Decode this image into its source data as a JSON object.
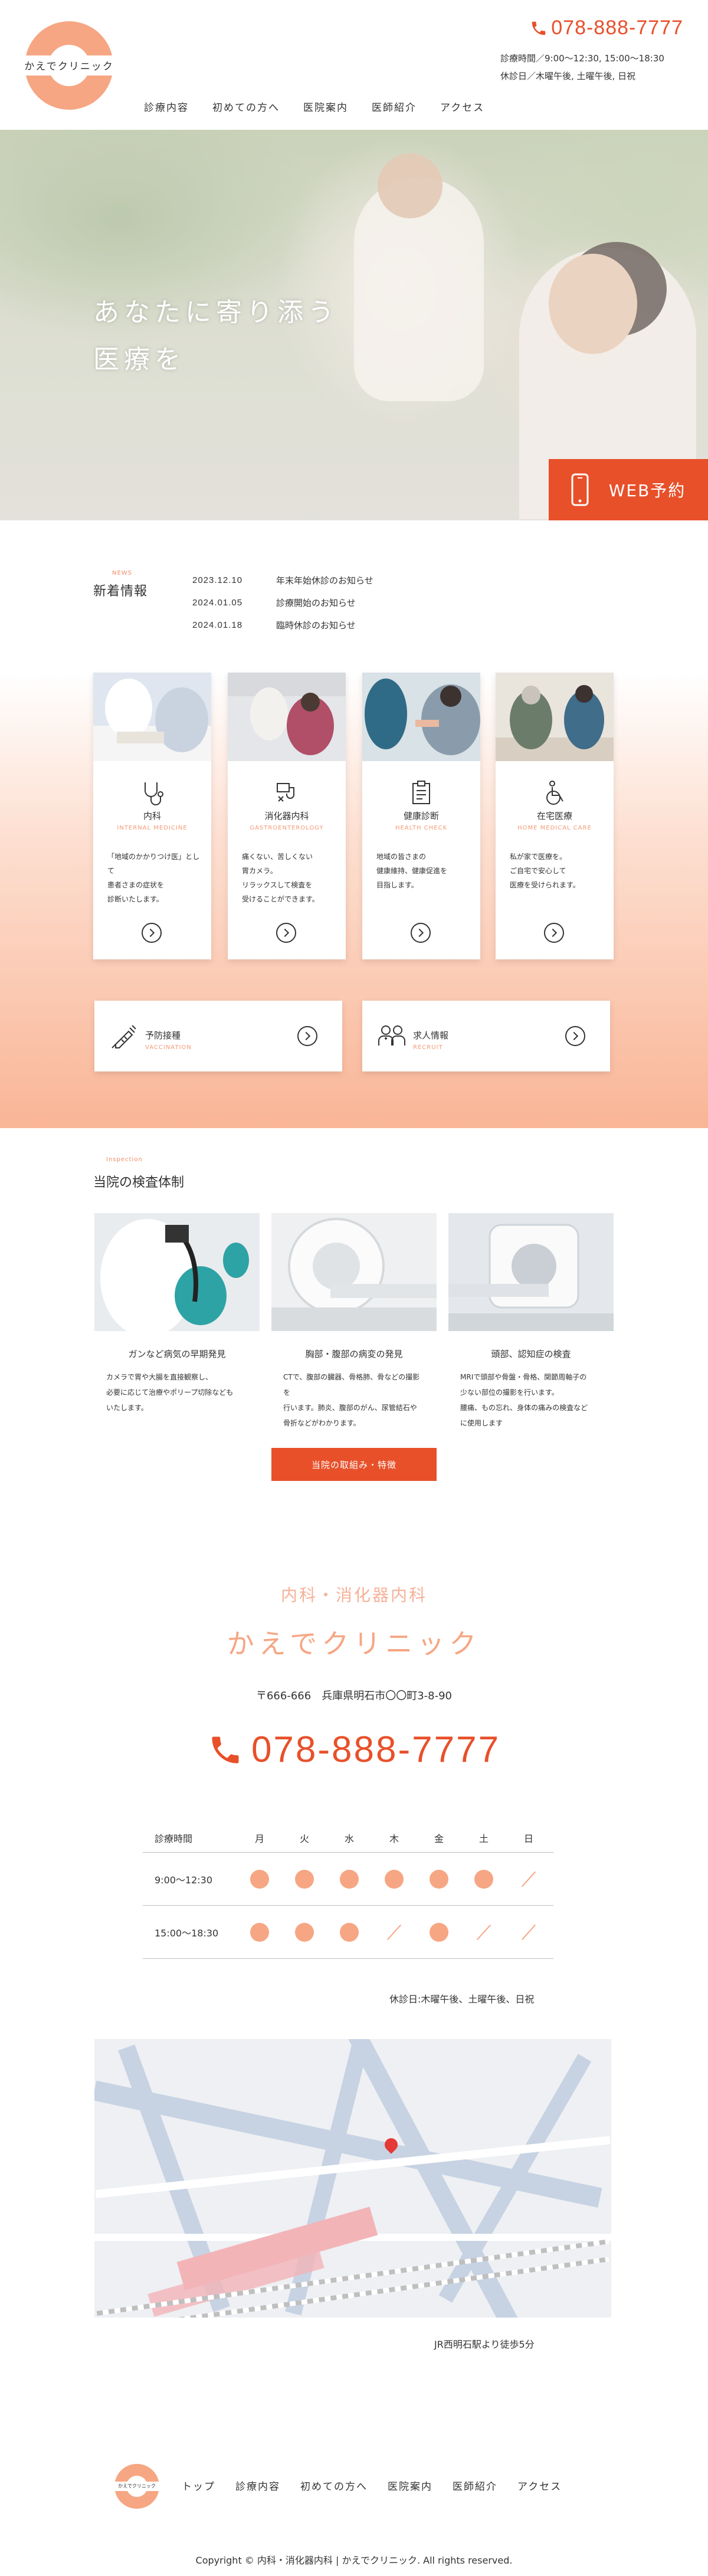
{
  "header": {
    "logo_text": "かえでクリニック",
    "tel": "078-888-7777",
    "hours_line": "診療時間／9:00～12:30, 15:00～18:30",
    "closed_line": "休診日／木曜午後, 土曜午後, 日祝"
  },
  "nav": [
    "診療内容",
    "初めての方へ",
    "医院案内",
    "医師紹介",
    "アクセス"
  ],
  "hero": {
    "copy_line1": "あなたに寄り添う",
    "copy_line2": "医療を",
    "web_button": "WEB予約"
  },
  "news": {
    "label_en": "NEWS",
    "title": "新着情報",
    "items": [
      {
        "date": "2023.12.10",
        "text": "年末年始休診のお知らせ"
      },
      {
        "date": "2024.01.05",
        "text": "診療開始のお知らせ"
      },
      {
        "date": "2024.01.18",
        "text": "臨時休診のお知らせ"
      }
    ]
  },
  "services": [
    {
      "title": "内科",
      "en": "INTERNAL MEDICINE",
      "desc": [
        "「地域のかかりつけ医」として",
        "患者さまの症状を",
        "診断いたします。"
      ],
      "icon": "stethoscope-icon",
      "photo": "doctor-consultation"
    },
    {
      "title": "消化器内科",
      "en": "GASTROENTEROLOGY",
      "desc": [
        "痛くない、苦しくない",
        "胃カメラ。",
        "リラックスして検査を",
        "受けることができます。"
      ],
      "icon": "endoscope-icon",
      "photo": "patient-consultation"
    },
    {
      "title": "健康診断",
      "en": "HEALTH CHECK",
      "desc": [
        "地域の皆さまの",
        "健康維持、健康促進を",
        "目指します。"
      ],
      "icon": "clipboard-icon",
      "photo": "injection"
    },
    {
      "title": "在宅医療",
      "en": "HOME MEDICAL CARE",
      "desc": [
        "私が家で医療を。",
        "ご自宅で安心して",
        "医療を受けられます。"
      ],
      "icon": "wheelchair-icon",
      "photo": "home-care"
    }
  ],
  "wide_cards": [
    {
      "title": "予防接種",
      "en": "VACCINATION",
      "icon": "syringe-icon"
    },
    {
      "title": "求人情報",
      "en": "RECRUIT",
      "icon": "staff-icon"
    }
  ],
  "inspection": {
    "label_en": "Inspection",
    "title": "当院の検査体制",
    "items": [
      {
        "head": "ガンなど病気の早期発見",
        "desc": [
          "カメラで胃や大腸を直接観察し、",
          "必要に応じて治療やポリープ切除なども",
          "いたします。"
        ]
      },
      {
        "head": "胸部・腹部の病変の発見",
        "desc": [
          "CTで、腹部の臓器、骨格肺、骨などの撮影を",
          "行います。肺炎、腹部のがん、尿管結石や",
          "骨折などがわかります。"
        ]
      },
      {
        "head": "頭部、認知症の検査",
        "desc": [
          "MRIで頭部や骨盤・骨格、関節周軸子の",
          "少ない部位の撮影を行います。",
          "腰痛、もの忘れ、身体の痛みの検査など",
          "に使用します"
        ]
      }
    ],
    "button": "当院の取組み・特徴"
  },
  "clinic": {
    "sub": "内科・消化器内科",
    "name": "かえでクリニック",
    "address": "〒666-666　兵庫県明石市〇〇町3-8-90",
    "tel": "078-888-7777"
  },
  "hours_table": {
    "label": "診療時間",
    "days": [
      "月",
      "火",
      "水",
      "木",
      "金",
      "土",
      "日"
    ],
    "rows": [
      {
        "time": "9:00～12:30",
        "open": [
          true,
          true,
          true,
          true,
          true,
          true,
          false
        ]
      },
      {
        "time": "15:00～18:30",
        "open": [
          true,
          true,
          true,
          false,
          true,
          false,
          false
        ]
      }
    ],
    "closed_note": "休診日:木曜午後、土曜午後、日祝"
  },
  "map": {
    "station_note": "JR西明石駅より徒歩5分"
  },
  "footer": {
    "logo_text": "かえでクリニック",
    "nav": [
      "トップ",
      "診療内容",
      "初めての方へ",
      "医院案内",
      "医師紹介",
      "アクセス"
    ],
    "copyright": "Copyright © 内科・消化器内科 | かえでクリニック. All rights reserved."
  },
  "colors": {
    "accent": "#e8502a",
    "brand": "#f6a683"
  }
}
